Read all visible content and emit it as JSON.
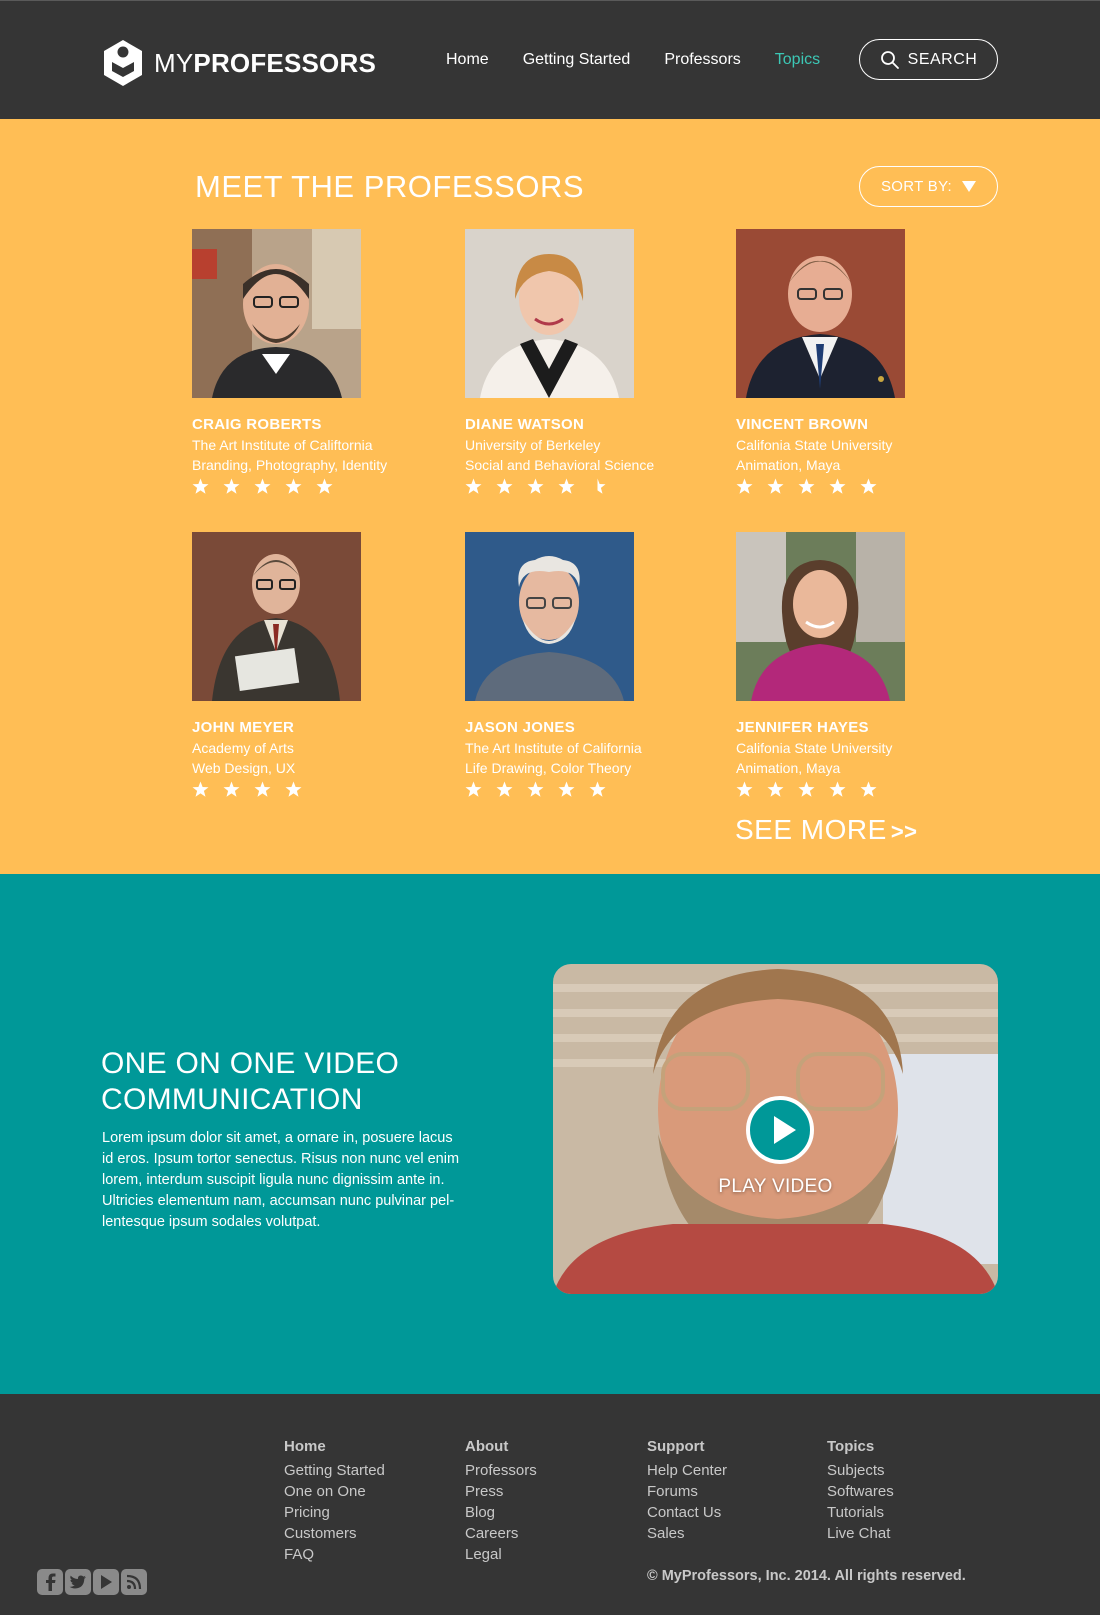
{
  "header": {
    "logo_text_bold": "MY",
    "logo_text_rest": "PROFESSORS",
    "nav": [
      "Home",
      "Getting Started",
      "Professors",
      "Topics"
    ],
    "active_nav": "Topics",
    "search_label": "SEARCH"
  },
  "professors_section": {
    "title": "MEET THE PROFESSORS",
    "sort_label": "SORT BY:",
    "see_more": "SEE MORE",
    "see_more_arrow": ">>",
    "cards": [
      {
        "name": "CRAIG ROBERTS",
        "school": "The Art Institute of Califtornia",
        "subjects": "Branding, Photography, Identity",
        "rating": 5
      },
      {
        "name": "DIANE WATSON",
        "school": "University of Berkeley",
        "subjects": "Social and Behavioral Science",
        "rating": 4.5
      },
      {
        "name": "VINCENT BROWN",
        "school": "Califonia State University",
        "subjects": "Animation, Maya",
        "rating": 5
      },
      {
        "name": "JOHN MEYER",
        "school": "Academy of Arts",
        "subjects": "Web Design, UX",
        "rating": 4
      },
      {
        "name": "JASON JONES",
        "school": "The Art Institute of California",
        "subjects": "Life Drawing, Color Theory",
        "rating": 5
      },
      {
        "name": "JENNIFER HAYES",
        "school": "Califonia State University",
        "subjects": "Animation, Maya",
        "rating": 5
      }
    ]
  },
  "video_section": {
    "title": "ONE ON ONE VIDEO COMMUNICATION",
    "body": "Lorem ipsum dolor sit amet, a ornare in, posuere lacus id eros. Ipsum tortor senectus. Risus non nunc vel enim lorem, interdum suscipit ligula nunc dignissim ante in. Ultricies elementum nam, accumsan nunc pulvinar pel-lentesque ipsum sodales volutpat.",
    "play_label": "PLAY VIDEO"
  },
  "footer": {
    "columns": [
      {
        "head": "Home",
        "links": [
          "Getting Started",
          "One on One",
          "Pricing",
          "Customers",
          "FAQ"
        ]
      },
      {
        "head": "About",
        "links": [
          "Professors",
          "Press",
          "Blog",
          "Careers",
          "Legal"
        ]
      },
      {
        "head": "Support",
        "links": [
          "Help Center",
          "Forums",
          "Contact Us",
          "Sales"
        ]
      },
      {
        "head": "Topics",
        "links": [
          "Subjects",
          "Softwares",
          "Tutorials",
          "Live Chat"
        ]
      }
    ],
    "social_icons": [
      "facebook-icon",
      "twitter-icon",
      "youtube-icon",
      "rss-icon"
    ],
    "copyright": "© MyProfessors, Inc. 2014. All rights reserved."
  },
  "colors": {
    "header_bg": "#353535",
    "accent_orange": "#ffbe55",
    "accent_teal": "#009898",
    "active_nav": "#3cc7b5"
  }
}
